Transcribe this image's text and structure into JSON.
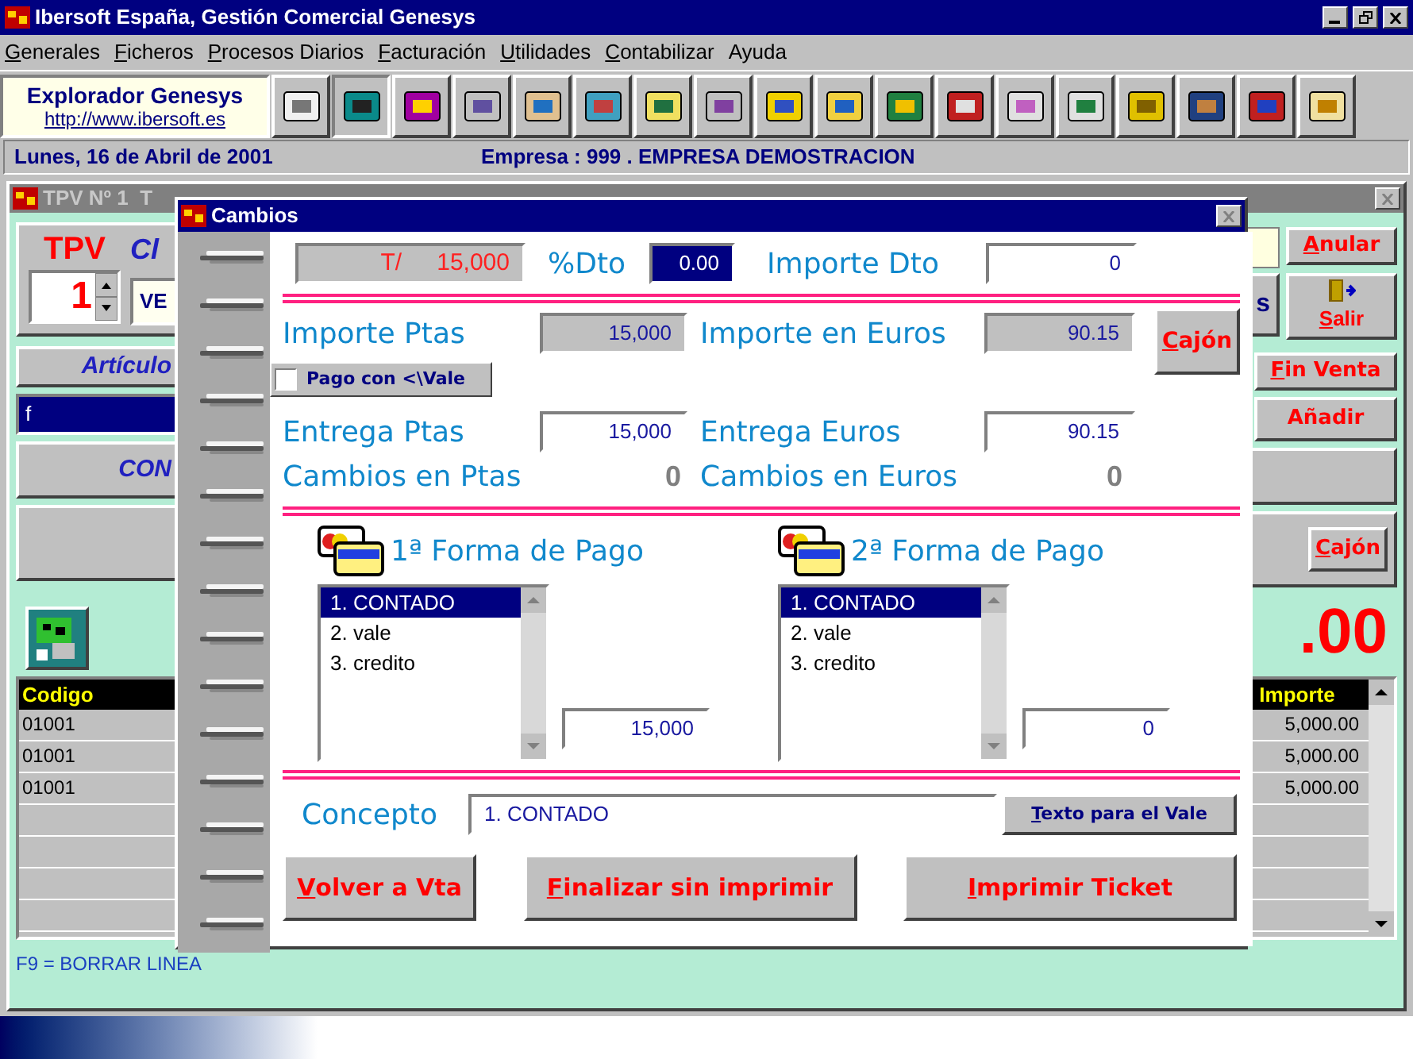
{
  "window": {
    "title": "Ibersoft España, Gestión Comercial Genesys"
  },
  "menu": [
    {
      "label": "Generales",
      "key_underlined": true
    },
    {
      "label": "Ficheros",
      "key_underlined": true
    },
    {
      "label": "Procesos Diarios",
      "key_underlined": true
    },
    {
      "label": "Facturación",
      "key_underlined": true
    },
    {
      "label": "Utilidades",
      "key_underlined": true
    },
    {
      "label": "Contabilizar",
      "key_underlined": true
    },
    {
      "label": "Ayuda",
      "key_underlined": false
    }
  ],
  "explorer": {
    "title": "Explorador Genesys",
    "link": "http://www.ibersoft.es"
  },
  "info_bar": {
    "date": "Lunes, 16 de Abril de 2001",
    "company": "Empresa : 999 . EMPRESA DEMOSTRACION"
  },
  "tpv_window": {
    "title": "TPV Nº 1  T",
    "tpv_label": "TPV",
    "tpv_number": "1",
    "client_label": "Cl",
    "client_value": "VE",
    "article_label": "Artículo",
    "article_input": "f",
    "concept_label": "CON",
    "anular": {
      "label": "Anular",
      "key_underlined": true
    },
    "partial_button": "s",
    "salir": {
      "label": "Salir",
      "key_underlined": true
    },
    "fin_venta": {
      "label": "Fin Venta",
      "key_underlined": true
    },
    "anadir": {
      "label": "Añadir",
      "key_underlined": false
    },
    "cajon": {
      "label": "Cajón",
      "key_underlined": true
    },
    "total": ".00",
    "table": {
      "columns": [
        "Codigo",
        "Importe"
      ],
      "rows": [
        [
          "01001",
          "5,000.00"
        ],
        [
          "01001",
          "5,000.00"
        ],
        [
          "01001",
          "5,000.00"
        ]
      ]
    },
    "hint": "F9 = BORRAR LINEA"
  },
  "dialog": {
    "title": "Cambios",
    "total_prefix": "T/",
    "total_value": "15,000",
    "dto_label": "%Dto",
    "dto_value": "0.00",
    "importe_dto_label": "Importe Dto",
    "importe_dto_value": "0",
    "importe_ptas_label": "Importe Ptas",
    "importe_ptas_value": "15,000",
    "importe_euros_label": "Importe en Euros",
    "importe_euros_value": "90.15",
    "cajon": {
      "label": "Cajón",
      "key_underlined": true
    },
    "vale_checkbox": {
      "label": "Pago con <\\Vale",
      "checked": false
    },
    "entrega_ptas_label": "Entrega Ptas",
    "entrega_ptas_value": "15,000",
    "entrega_euros_label": "Entrega Euros",
    "entrega_euros_value": "90.15",
    "cambios_ptas_label": "Cambios en Ptas",
    "cambios_ptas_value": "0",
    "cambios_euros_label": "Cambios en Euros",
    "cambios_euros_value": "0",
    "payment_forms": [
      {
        "title": "1ª Forma de Pago",
        "amount": "15,000",
        "options": [
          {
            "label": "1. CONTADO",
            "selected": true
          },
          {
            "label": "2. vale",
            "selected": false
          },
          {
            "label": "3. credito",
            "selected": false
          }
        ]
      },
      {
        "title": "2ª Forma de Pago",
        "amount": "0",
        "options": [
          {
            "label": "1. CONTADO",
            "selected": true
          },
          {
            "label": "2. vale",
            "selected": false
          },
          {
            "label": "3. credito",
            "selected": false
          }
        ]
      }
    ],
    "concepto_label": "Concepto",
    "concepto_value": "1. CONTADO",
    "texto_vale": {
      "label": "Texto para el Vale",
      "key_underlined": true
    },
    "actions": [
      {
        "label": "Volver a Vta",
        "key_underlined": true
      },
      {
        "label": "Finalizar sin imprimir",
        "key_underlined": true
      },
      {
        "label": "Imprimir Ticket",
        "key_underlined": true
      }
    ]
  }
}
